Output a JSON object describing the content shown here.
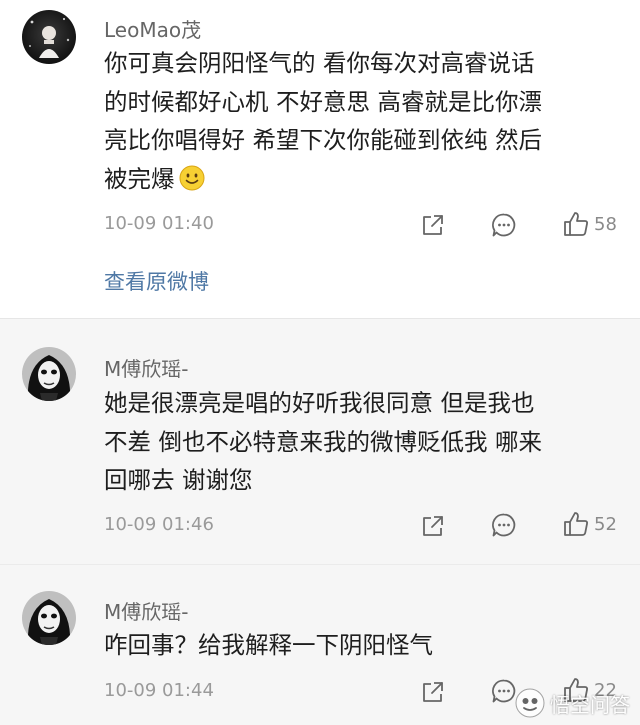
{
  "comments": [
    {
      "username": "LeoMao茂",
      "lines": [
        "你可真会阴阳怪气的 看你每次对高睿说话",
        "的时候都好心机 不好意思 高睿就是比你漂",
        "亮比你唱得好 希望下次你能碰到依纯 然后",
        "被完爆"
      ],
      "timestamp": "10-09 01:40",
      "likes": "58",
      "link_label": "查看原微博"
    },
    {
      "username": "M傅欣瑶-",
      "lines": [
        "她是很漂亮是唱的好听我很同意 但是我也",
        "不差 倒也不必特意来我的微博贬低我 哪来",
        "回哪去 谢谢您"
      ],
      "timestamp": "10-09 01:46",
      "likes": "52"
    },
    {
      "username": "M傅欣瑶-",
      "lines": [
        "咋回事？给我解释一下阴阳怪气"
      ],
      "timestamp": "10-09 01:44",
      "likes": "22"
    }
  ],
  "watermark": {
    "text": "悟空问答"
  },
  "icons": {
    "share": "share-icon",
    "comment": "comment-icon",
    "like": "thumbs-up-icon",
    "emoji": "smiley-emoji-icon"
  },
  "colors": {
    "link": "#4f78a5",
    "username": "#666666",
    "muted": "#9a9a9a",
    "alt_background": "#f6f6f6"
  }
}
